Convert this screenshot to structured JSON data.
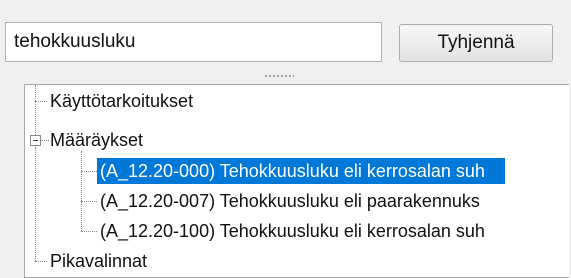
{
  "search": {
    "value": "tehokkuusluku"
  },
  "toolbar": {
    "clear_label": "Tyhjennä"
  },
  "tree": {
    "items": [
      {
        "label": "Käyttötarkoitukset"
      },
      {
        "label": "Määräykset",
        "expanded": true
      },
      {
        "label": "(A_12.20-000) Tehokkuusluku eli kerrosalan suh",
        "selected": true
      },
      {
        "label": "(A_12.20-007) Tehokkuusluku eli paarakennuks"
      },
      {
        "label": "(A_12.20-100) Tehokkuusluku eli kerrosalan suh"
      },
      {
        "label": "Pikavalinnat"
      }
    ]
  },
  "colors": {
    "selection": "#0078d7",
    "tree_background": "#ffffff",
    "window_background": "#f0f0f0"
  }
}
